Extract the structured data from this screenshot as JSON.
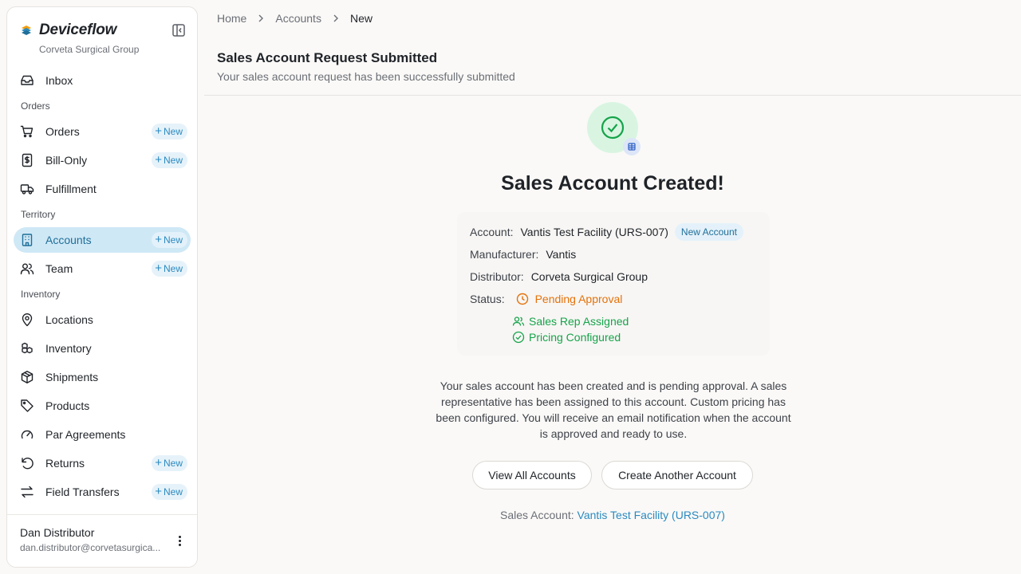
{
  "brand": {
    "name": "Deviceflow",
    "org": "Corveta Surgical Group"
  },
  "sidebar": {
    "new_label": "New",
    "items": [
      {
        "label": "Inbox",
        "icon": "inbox-icon"
      },
      {
        "section": "Orders"
      },
      {
        "label": "Orders",
        "icon": "cart-icon",
        "new": true
      },
      {
        "label": "Bill-Only",
        "icon": "receipt-icon",
        "new": true
      },
      {
        "label": "Fulfillment",
        "icon": "truck-icon"
      },
      {
        "section": "Territory"
      },
      {
        "label": "Accounts",
        "icon": "building-icon",
        "new": true,
        "active": true
      },
      {
        "label": "Team",
        "icon": "users-icon",
        "new": true
      },
      {
        "section": "Inventory"
      },
      {
        "label": "Locations",
        "icon": "map-pin-icon"
      },
      {
        "label": "Inventory",
        "icon": "boxes-icon"
      },
      {
        "label": "Shipments",
        "icon": "package-icon"
      },
      {
        "label": "Products",
        "icon": "tag-icon"
      },
      {
        "label": "Par Agreements",
        "icon": "gauge-icon"
      },
      {
        "label": "Returns",
        "icon": "return-icon",
        "new": true
      },
      {
        "label": "Field Transfers",
        "icon": "transfer-icon",
        "new": true
      }
    ]
  },
  "user": {
    "name": "Dan Distributor",
    "email": "dan.distributor@corvetasurgica..."
  },
  "breadcrumb": [
    "Home",
    "Accounts",
    "New"
  ],
  "header": {
    "title": "Sales Account Request Submitted",
    "subtitle": "Your sales account request has been successfully submitted"
  },
  "result": {
    "title": "Sales Account Created!",
    "account_label": "Account:",
    "account_value": "Vantis Test Facility (URS-007)",
    "account_tag": "New Account",
    "manufacturer_label": "Manufacturer:",
    "manufacturer_value": "Vantis",
    "distributor_label": "Distributor:",
    "distributor_value": "Corveta Surgical Group",
    "status_label": "Status:",
    "status_value": "Pending Approval",
    "rep_assigned": "Sales Rep Assigned",
    "pricing_configured": "Pricing Configured",
    "message": "Your sales account has been created and is pending approval. A sales representative has been assigned to this account. Custom pricing has been configured. You will receive an email notification when the account is approved and ready to use.",
    "view_all_button": "View All Accounts",
    "create_another_button": "Create Another Account",
    "footer_label": "Sales Account:",
    "footer_link": "Vantis Test Facility (URS-007)"
  },
  "colors": {
    "accent": "#2b8ac0",
    "active_bg": "#cfe8f6",
    "success": "#16a34a",
    "warning": "#e5710a"
  }
}
